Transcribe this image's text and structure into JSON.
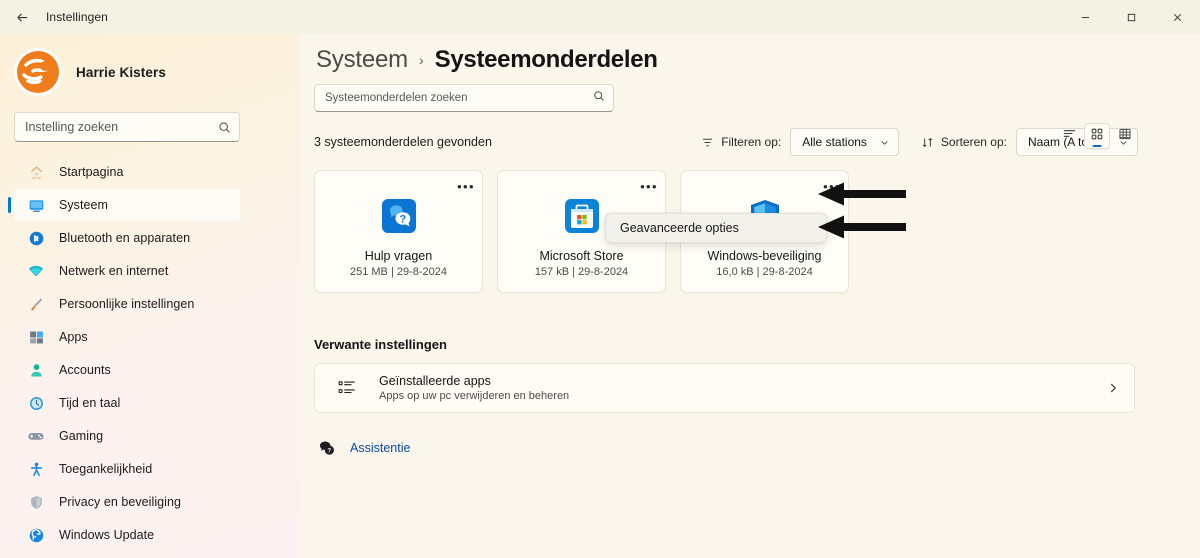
{
  "titlebar": {
    "back_icon": "back-arrow-icon",
    "title": "Instellingen",
    "minimize": "—",
    "maximize": "□",
    "close": "✕"
  },
  "sidebar": {
    "profile": {
      "name": "Harrie Kisters",
      "avatar_icon": "user-avatar"
    },
    "search": {
      "placeholder": "Instelling zoeken",
      "value": "",
      "icon": "search-icon"
    },
    "items": [
      {
        "label": "Startpagina",
        "icon": "home-icon",
        "active": false
      },
      {
        "label": "Systeem",
        "icon": "monitor-icon",
        "active": true
      },
      {
        "label": "Bluetooth en apparaten",
        "icon": "bluetooth-icon",
        "active": false
      },
      {
        "label": "Netwerk en internet",
        "icon": "wifi-icon",
        "active": false
      },
      {
        "label": "Persoonlijke instellingen",
        "icon": "paintbrush-icon",
        "active": false
      },
      {
        "label": "Apps",
        "icon": "apps-icon",
        "active": false
      },
      {
        "label": "Accounts",
        "icon": "account-icon",
        "active": false
      },
      {
        "label": "Tijd en taal",
        "icon": "clock-icon",
        "active": false
      },
      {
        "label": "Gaming",
        "icon": "gamepad-icon",
        "active": false
      },
      {
        "label": "Toegankelijkheid",
        "icon": "accessibility-icon",
        "active": false
      },
      {
        "label": "Privacy en beveiliging",
        "icon": "shield-icon",
        "active": false
      },
      {
        "label": "Windows Update",
        "icon": "update-icon",
        "active": false
      }
    ]
  },
  "main": {
    "breadcrumb": {
      "parent": "Systeem",
      "separator": "›",
      "current": "Systeemonderdelen"
    },
    "page_search": {
      "placeholder": "Systeemonderdelen zoeken",
      "value": "",
      "icon": "search-icon"
    },
    "view_toggle": {
      "options": [
        {
          "name": "list-view",
          "icon": "list-icon",
          "selected": false
        },
        {
          "name": "grid-view",
          "icon": "grid-icon",
          "selected": true
        },
        {
          "name": "table-view",
          "icon": "table-icon",
          "selected": false
        }
      ]
    },
    "result_count": "3 systeemonderdelen gevonden",
    "filter": {
      "label": "Filteren op:",
      "value": "Alle stations",
      "icon": "filter-icon",
      "chevron": "chevron-down-icon"
    },
    "sort": {
      "label": "Sorteren op:",
      "value": "Naam (A tot Z)",
      "icon": "sort-icon",
      "chevron": "chevron-down-icon"
    },
    "cards": [
      {
        "name": "Hulp vragen",
        "meta": "251 MB | 29-8-2024",
        "icon": "help-app-icon",
        "menu": "•••"
      },
      {
        "name": "Microsoft Store",
        "meta": "157 kB | 29-8-2024",
        "icon": "microsoft-store-icon",
        "menu": "•••"
      },
      {
        "name": "Windows-beveiliging",
        "meta": "16,0 kB | 29-8-2024",
        "icon": "windows-security-icon",
        "menu": "•••"
      }
    ],
    "flyout": {
      "label": "Geavanceerde opties"
    },
    "related": {
      "title": "Verwante instellingen",
      "item": {
        "title": "Geïnstalleerde apps",
        "subtitle": "Apps op uw pc verwijderen en beheren",
        "icon": "applist-icon",
        "chevron": "chevron-right-icon"
      }
    },
    "help": {
      "label": "Assistentie",
      "icon": "help-bubble-icon"
    }
  },
  "colors": {
    "accent": "#0078d4",
    "link": "#0a49b0",
    "page_bg": "#faf6ec",
    "sidebar_bg": "#fdf0d8",
    "card_bg": "#fffdf7"
  }
}
